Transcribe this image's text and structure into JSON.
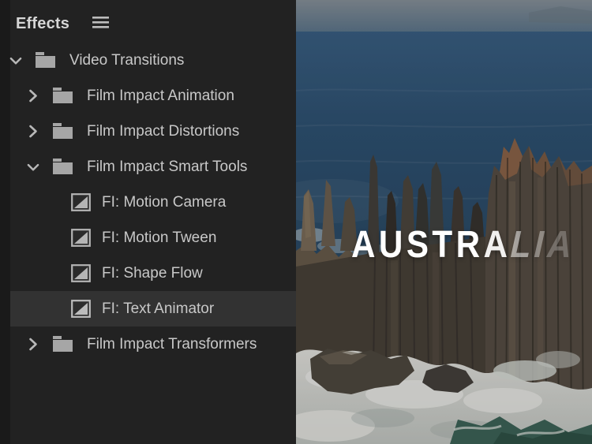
{
  "effects_panel": {
    "title": "Effects",
    "menu_icon": "hamburger-icon",
    "tree": [
      {
        "label": "Video Transitions",
        "type": "folder",
        "level": 0,
        "expanded": true,
        "selected": false
      },
      {
        "label": "Film Impact Animation",
        "type": "folder",
        "level": 1,
        "expanded": false,
        "selected": false
      },
      {
        "label": "Film Impact Distortions",
        "type": "folder",
        "level": 1,
        "expanded": false,
        "selected": false
      },
      {
        "label": "Film Impact Smart Tools",
        "type": "folder",
        "level": 1,
        "expanded": true,
        "selected": false
      },
      {
        "label": "FI: Motion Camera",
        "type": "effect",
        "level": 2,
        "selected": false
      },
      {
        "label": "FI: Motion Tween",
        "type": "effect",
        "level": 2,
        "selected": false
      },
      {
        "label": "FI: Shape Flow",
        "type": "effect",
        "level": 2,
        "selected": false
      },
      {
        "label": "FI: Text Animator",
        "type": "effect",
        "level": 2,
        "selected": true
      },
      {
        "label": "Film Impact Transformers",
        "type": "folder",
        "level": 1,
        "expanded": false,
        "selected": false
      }
    ],
    "icons": {
      "folder": "folder-icon",
      "effect": "transition-icon",
      "expanded": "chevron-down-icon",
      "collapsed": "chevron-right-icon"
    }
  },
  "video_preview": {
    "overlay_title": "AUSTRALIA",
    "title_letters": [
      {
        "char": "A",
        "opacity": 1,
        "skew": 0
      },
      {
        "char": "U",
        "opacity": 1,
        "skew": 0
      },
      {
        "char": "S",
        "opacity": 1,
        "skew": 0
      },
      {
        "char": "T",
        "opacity": 1,
        "skew": 0
      },
      {
        "char": "R",
        "opacity": 1,
        "skew": 0
      },
      {
        "char": "A",
        "opacity": 0.92,
        "skew": 0
      },
      {
        "char": "L",
        "opacity": 0.5,
        "skew": -14
      },
      {
        "char": "I",
        "opacity": 0.36,
        "skew": -14
      },
      {
        "char": "A",
        "opacity": 0.24,
        "skew": -14
      }
    ]
  },
  "colors": {
    "panel_bg": "#222222",
    "panel_left_strip": "#1a1a1a",
    "row_selected_bg": "#323232",
    "row_text": "#c8c8c8",
    "icon_gray": "#a8a8a8",
    "title_text": "#ffffff",
    "ocean_blue": "#2e5273",
    "sky_haze": "#8b949c",
    "rock_tan": "#7e6d58",
    "rock_orange": "#996a48",
    "foam_white": "#eceae4",
    "sea_teal": "#3d6557"
  }
}
